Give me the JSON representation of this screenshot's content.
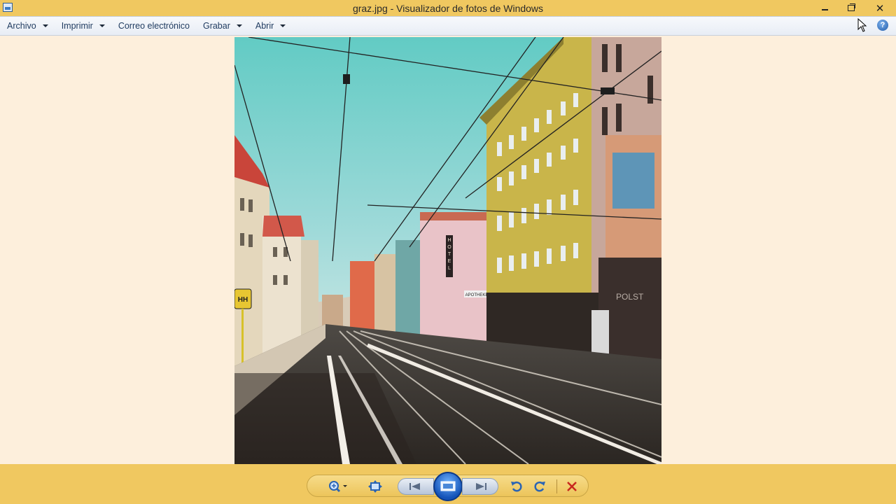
{
  "window": {
    "title": "graz.jpg - Visualizador de fotos de Windows",
    "icon": "photo-viewer-app-icon",
    "controls": [
      "minimize-icon",
      "restore-icon",
      "close-icon"
    ]
  },
  "menu": {
    "items": [
      {
        "label": "Archivo",
        "has_dropdown": true
      },
      {
        "label": "Imprimir",
        "has_dropdown": true
      },
      {
        "label": "Correo electrónico",
        "has_dropdown": false
      },
      {
        "label": "Grabar",
        "has_dropdown": true
      },
      {
        "label": "Abrir",
        "has_dropdown": true
      }
    ],
    "help_label": "?"
  },
  "photo": {
    "subject": "Street with tram tracks and buildings",
    "signs": {
      "hotel": "HOTEL",
      "apotheke": "APOTHEKE",
      "polster": "POLST",
      "hh": "HH"
    }
  },
  "toolbar": {
    "buttons": [
      "zoom-icon",
      "actual-size-icon",
      "previous-icon",
      "slideshow-icon",
      "next-icon",
      "rotate-counterclockwise-icon",
      "rotate-clockwise-icon",
      "delete-icon"
    ]
  },
  "colors": {
    "titlebar": "#f0c860",
    "background": "#fdefdc",
    "menubar": "#eef2f8",
    "accent_blue": "#2a64b4",
    "delete_red": "#c8281e"
  }
}
